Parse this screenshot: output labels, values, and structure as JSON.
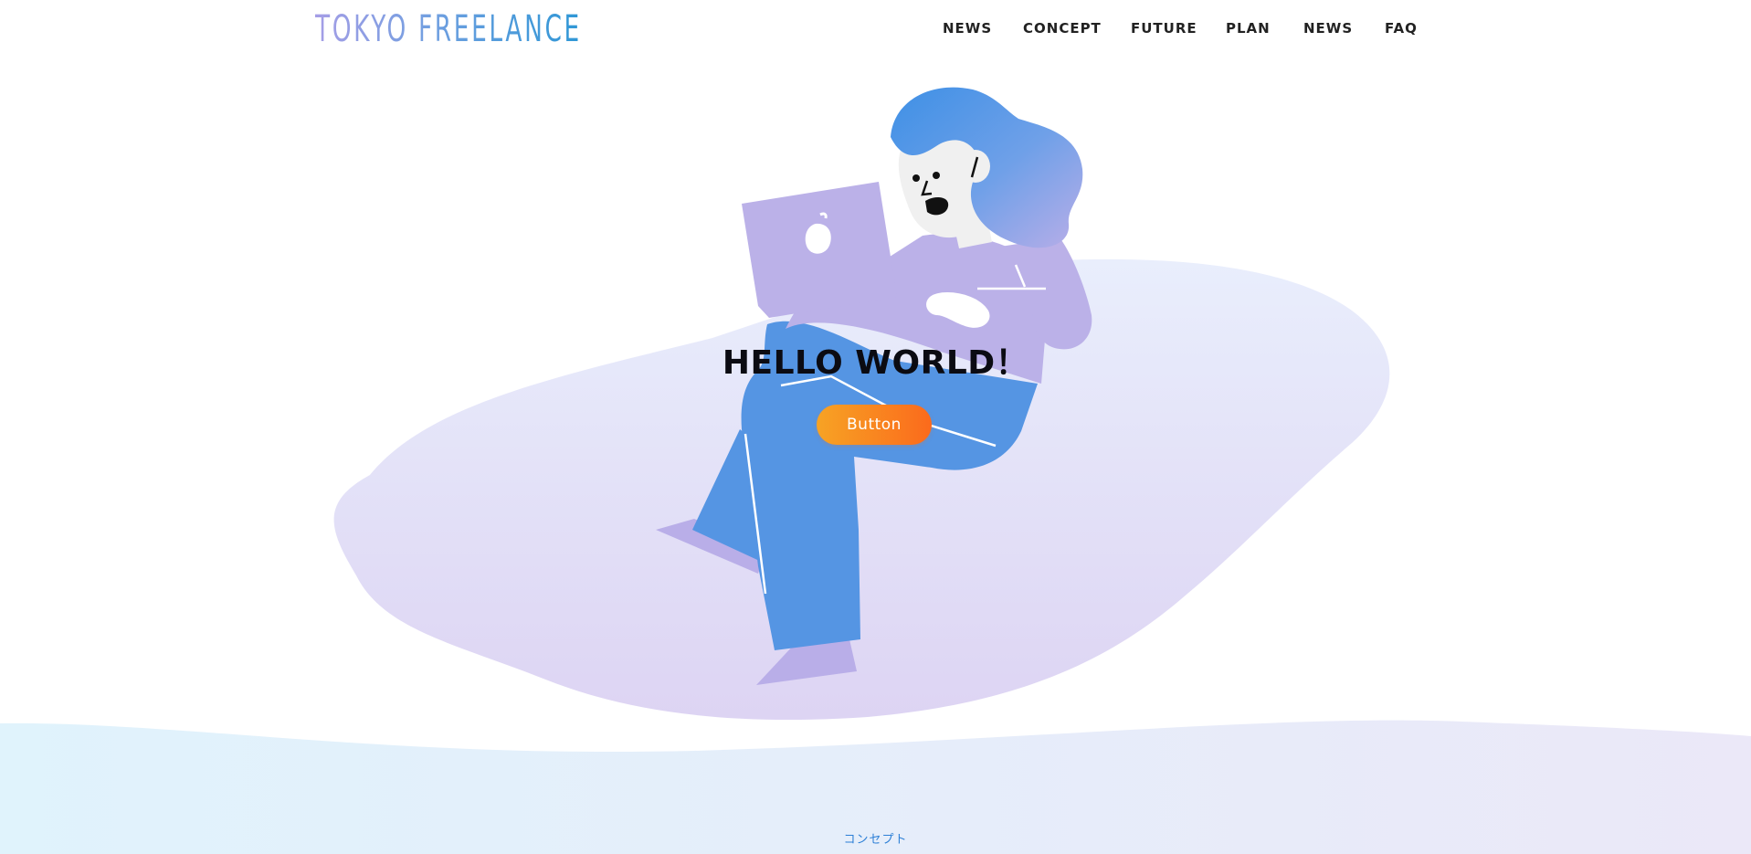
{
  "header": {
    "logo": "TOKYO FREELANCE",
    "nav": [
      {
        "label": "NEWS"
      },
      {
        "label": "CONCEPT"
      },
      {
        "label": "FUTURE"
      },
      {
        "label": "PLAN"
      },
      {
        "label": "NEWS"
      },
      {
        "label": "FAQ"
      }
    ]
  },
  "hero": {
    "title": "HELLO WORLD！",
    "button_label": "Button"
  },
  "concept": {
    "label": "コンセプト"
  },
  "colors": {
    "accent_orange": "#fb6a1c",
    "brand_blue": "#2f97d6",
    "illustration_blue": "#5595e3",
    "illustration_lavender": "#bbb1e8"
  }
}
